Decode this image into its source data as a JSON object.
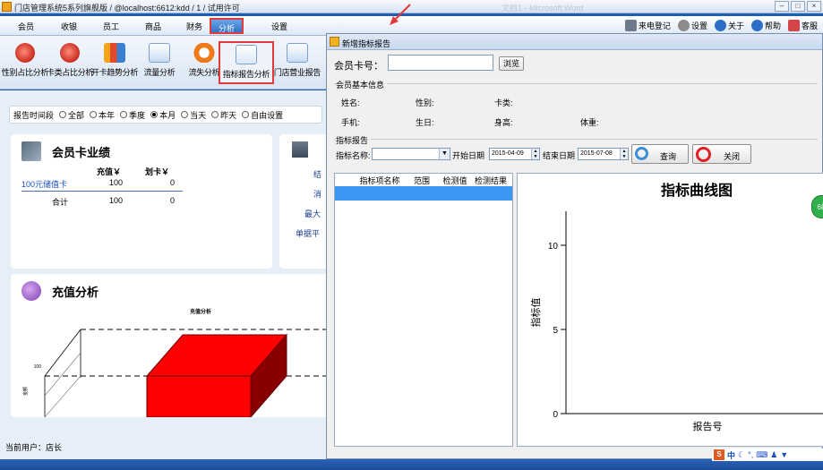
{
  "window": {
    "title": "门店管理系统5系列旗舰版 / @localhost:6612:kdd / 1 / 试用许可",
    "ghost": "文档1 - Microsoft Word"
  },
  "menu": {
    "items": [
      "会员",
      "收银",
      "员工",
      "商品",
      "财务",
      "分析",
      "设置"
    ],
    "active": "分析",
    "right": [
      {
        "label": "来电登记",
        "icon": "phone-icon",
        "color": "#6c7a8c"
      },
      {
        "label": "设置",
        "icon": "gear-icon",
        "color": "#8c8c8c"
      },
      {
        "label": "关于",
        "icon": "info-icon",
        "color": "#2b6fc8"
      },
      {
        "label": "帮助",
        "icon": "help-icon",
        "color": "#2b6fc8"
      },
      {
        "label": "客服",
        "icon": "user-icon",
        "color": "#d64545"
      }
    ]
  },
  "toolbar": {
    "items": [
      {
        "label": "性别占比分析",
        "icon": "pie-chart-icon",
        "color": "#d4372c"
      },
      {
        "label": "卡类占比分析",
        "icon": "pie-chart-icon",
        "color": "#d4372c"
      },
      {
        "label": "开卡趋势分析",
        "icon": "bar-chart-icon",
        "color": "#f2a51a"
      },
      {
        "label": "流量分析",
        "icon": "bar-chart-icon",
        "color": "#3a7fd0"
      },
      {
        "label": "流失分析",
        "icon": "lifebuoy-icon",
        "color": "#f07a1a"
      },
      {
        "label": "指标报告分析",
        "icon": "line-chart-icon",
        "color": "#4a8fd8"
      },
      {
        "label": "门店营业报告",
        "icon": "bar-chart-icon",
        "color": "#3a7fd0"
      }
    ],
    "selected": "指标报告分析"
  },
  "filter": {
    "label": "报告时间段",
    "options": [
      "全部",
      "本年",
      "季度",
      "本月",
      "当天",
      "昨天",
      "自由设置"
    ],
    "selected": "本月"
  },
  "card_panel": {
    "title": "会员卡业绩",
    "headers": [
      "充值￥",
      "划卡￥"
    ],
    "rows": [
      {
        "name": "100元储值卡",
        "recharge": "100",
        "swipe": "0"
      }
    ],
    "total": {
      "name": "合计",
      "recharge": "100",
      "swipe": "0"
    }
  },
  "side_panel": {
    "items": [
      "结",
      "消",
      "最大",
      "单据平"
    ]
  },
  "recharge_panel": {
    "title": "充值分析",
    "chart_data": {
      "type": "bar",
      "title": "充值分析",
      "categories": [
        ""
      ],
      "values": [
        100
      ],
      "ylabel": "金额",
      "ytick": "100",
      "color": "#ff0000"
    }
  },
  "status": {
    "current_user": "当前用户：店长"
  },
  "dialog": {
    "title": "新增指标报告",
    "card_label": "会员卡号：",
    "card_value": "",
    "browse_button": "浏览",
    "basic_group": "会员基本信息",
    "basic_fields": [
      "姓名:",
      "性别:",
      "卡类:",
      "手机:",
      "生日:",
      "身高:",
      "体重:"
    ],
    "report_group": "指标报告",
    "indicator_label": "指标名称:",
    "indicator_value": "",
    "start_label": "开始日期",
    "start_date": "2015-04-09",
    "end_label": "结束日期",
    "end_date": "2015-07-08",
    "query_button": "查询",
    "close_button": "关闭",
    "table_headers": [
      "指标项名称",
      "范围",
      "检测值",
      "检测结果"
    ],
    "chart_data": {
      "type": "line",
      "title": "指标曲线图",
      "xlabel": "报告号",
      "ylabel": "指标值",
      "yticks": [
        "10",
        "5",
        "0"
      ],
      "ylim": [
        0,
        10
      ],
      "series": []
    }
  },
  "tray": {
    "badge": "68",
    "ime": "中"
  }
}
